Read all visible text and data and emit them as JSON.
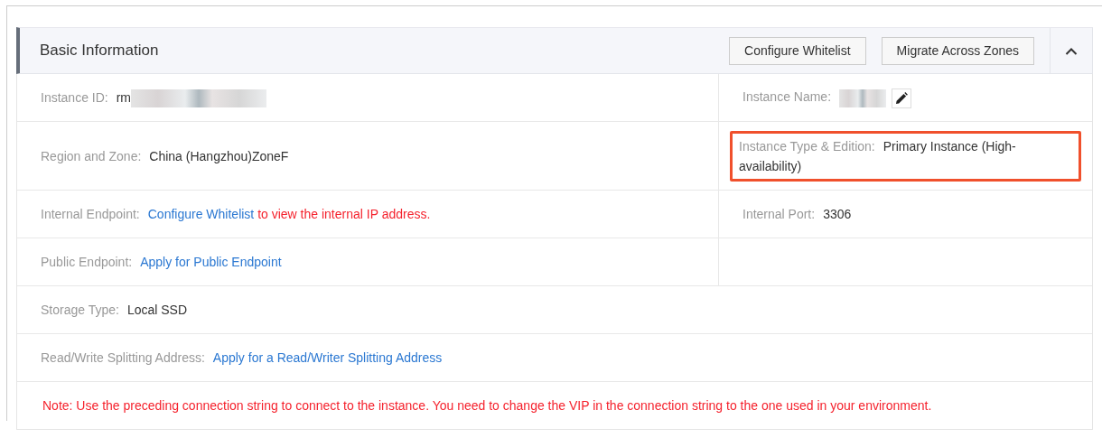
{
  "panel": {
    "title": "Basic Information",
    "expanded": true,
    "buttons": [
      "Configure Whitelist",
      "Migrate Across Zones"
    ],
    "rows": [
      {
        "cells": [
          {
            "label": "Instance ID:",
            "segments": [
              {
                "kind": "text",
                "text": "rm"
              }
            ],
            "redacted": true
          },
          {
            "label": "Instance Name:",
            "redacted": true,
            "editable": true
          }
        ]
      },
      {
        "cells": [
          {
            "label": "Region and Zone:",
            "segments": [
              {
                "kind": "text",
                "text": "China (Hangzhou)ZoneF"
              }
            ]
          },
          {
            "label": "Instance Type & Edition:",
            "segments": [
              {
                "kind": "text",
                "text": "Primary Instance (High-availability)"
              }
            ],
            "highlighted": true
          }
        ]
      },
      {
        "cells": [
          {
            "label": "Internal Endpoint:",
            "segments": [
              {
                "kind": "link",
                "text": "Configure Whitelist"
              },
              {
                "kind": "warning",
                "text": "to view the internal IP address."
              }
            ]
          },
          {
            "label": "Internal Port:",
            "segments": [
              {
                "kind": "text",
                "text": "3306"
              }
            ]
          }
        ]
      },
      {
        "cells": [
          {
            "label": "Public Endpoint:",
            "segments": [
              {
                "kind": "link",
                "text": "Apply for Public Endpoint"
              }
            ]
          }
        ]
      },
      {
        "full_width": true,
        "cells": [
          {
            "label": "Storage Type:",
            "segments": [
              {
                "kind": "text",
                "text": "Local SSD"
              }
            ]
          }
        ]
      },
      {
        "full_width": true,
        "cells": [
          {
            "label": "Read/Write Splitting Address:",
            "segments": [
              {
                "kind": "link",
                "text": "Apply for a Read/Writer Splitting Address"
              }
            ]
          }
        ]
      }
    ],
    "note": "Note: Use the preceding connection string to connect to the instance. You need to change the VIP in the connection string to the one used in your environment."
  }
}
